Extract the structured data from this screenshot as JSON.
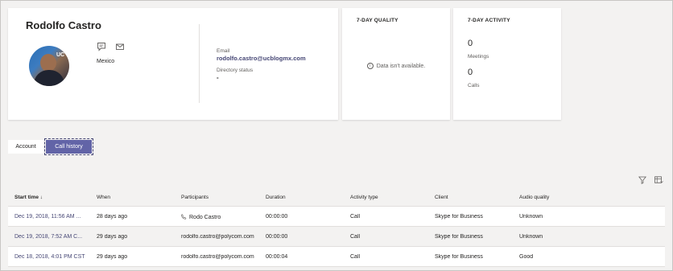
{
  "profile": {
    "name": "Rodolfo Castro",
    "location": "Mexico",
    "email_label": "Email",
    "email": "rodolfo.castro@ucblogmx.com",
    "directory_status_label": "Directory status",
    "directory_status": "-",
    "avatar_logo_text": "UC"
  },
  "quality": {
    "title": "7-DAY QUALITY",
    "message": "Data isn't available."
  },
  "activity": {
    "title": "7-DAY ACTIVITY",
    "meetings_value": "0",
    "meetings_label": "Meetings",
    "calls_value": "0",
    "calls_label": "Calls"
  },
  "tabs": {
    "account": "Account",
    "call_history": "Call history",
    "selected": "Call history"
  },
  "table": {
    "headers": [
      "Start time ↓",
      "When",
      "Participants",
      "Duration",
      "Activity type",
      "Client",
      "Audio quality"
    ],
    "rows": [
      [
        "Dec 19, 2018, 11:56 AM ...",
        "28 days ago",
        "Rodo Castro",
        "00:00:00",
        "Call",
        "Skype for Business",
        "Unknown"
      ],
      [
        "Dec 19, 2018, 7:52 AM C...",
        "29 days ago",
        "rodolfo.castro@polycom.com",
        "00:00:00",
        "Call",
        "Skype for Business",
        "Unknown"
      ],
      [
        "Dec 18, 2018, 4:01 PM CST",
        "29 days ago",
        "rodolfo.castro@polycom.com",
        "00:00:04",
        "Call",
        "Skype for Business",
        "Good"
      ]
    ]
  },
  "icons": {
    "chat": "chat-icon",
    "mail": "mail-icon",
    "info": "info-icon",
    "phone": "phone-icon",
    "filter": "filter-icon",
    "columns": "columns-icon"
  },
  "colors": {
    "accent": "#6264a7",
    "link": "#464775",
    "background": "#f3f2f1"
  }
}
